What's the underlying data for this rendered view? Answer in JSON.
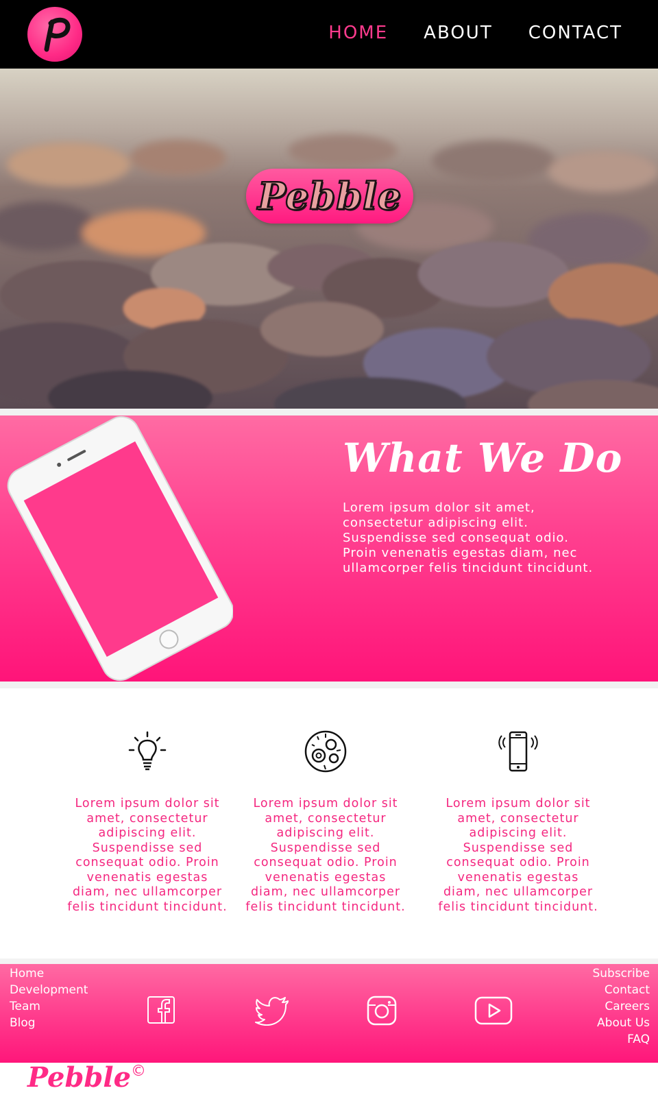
{
  "header": {
    "logo_letter": "P",
    "nav": [
      {
        "label": "HOME",
        "active": true
      },
      {
        "label": "ABOUT",
        "active": false
      },
      {
        "label": "CONTACT",
        "active": false
      }
    ]
  },
  "hero": {
    "brand": "Pebble"
  },
  "what": {
    "title": "What We Do",
    "lines": [
      "Lorem ipsum dolor sit amet,",
      "consectetur adipiscing elit.",
      "Suspendisse sed consequat odio.",
      "Proin venenatis egestas diam, nec",
      "ullamcorper felis tincidunt tincidunt."
    ]
  },
  "features": [
    {
      "icon": "lightbulb-icon",
      "lines": [
        "Lorem ipsum dolor sit",
        "amet, consectetur",
        "adipiscing elit.",
        "Suspendisse sed",
        "consequat odio. Proin",
        "venenatis egestas",
        "diam, nec ullamcorper",
        "felis tincidunt tincidunt."
      ]
    },
    {
      "icon": "gears-globe-icon",
      "lines": [
        "Lorem ipsum dolor sit",
        "amet, consectetur",
        "adipiscing elit.",
        "Suspendisse sed",
        "consequat odio. Proin",
        "venenatis egestas",
        "diam, nec ullamcorper",
        "felis tincidunt tincidunt."
      ]
    },
    {
      "icon": "vibrating-phone-icon",
      "lines": [
        "Lorem ipsum dolor sit",
        "amet, consectetur",
        "adipiscing elit.",
        "Suspendisse sed",
        "consequat odio. Proin",
        "venenatis egestas",
        "diam, nec ullamcorper",
        "felis tincidunt tincidunt."
      ]
    }
  ],
  "footer": {
    "left_links": [
      "Home",
      "Development",
      "Team",
      "Blog"
    ],
    "right_links": [
      "Subscribe",
      "Contact",
      "Careers",
      "About Us",
      "FAQ"
    ],
    "social": [
      "facebook-icon",
      "twitter-icon",
      "instagram-icon",
      "youtube-icon"
    ],
    "brand": "Pebble",
    "copyright_symbol": "©"
  },
  "colors": {
    "accent": "#ff2a86",
    "header_bg": "#000000",
    "nav_active": "#ff3b8e",
    "feature_text": "#f4267f"
  }
}
